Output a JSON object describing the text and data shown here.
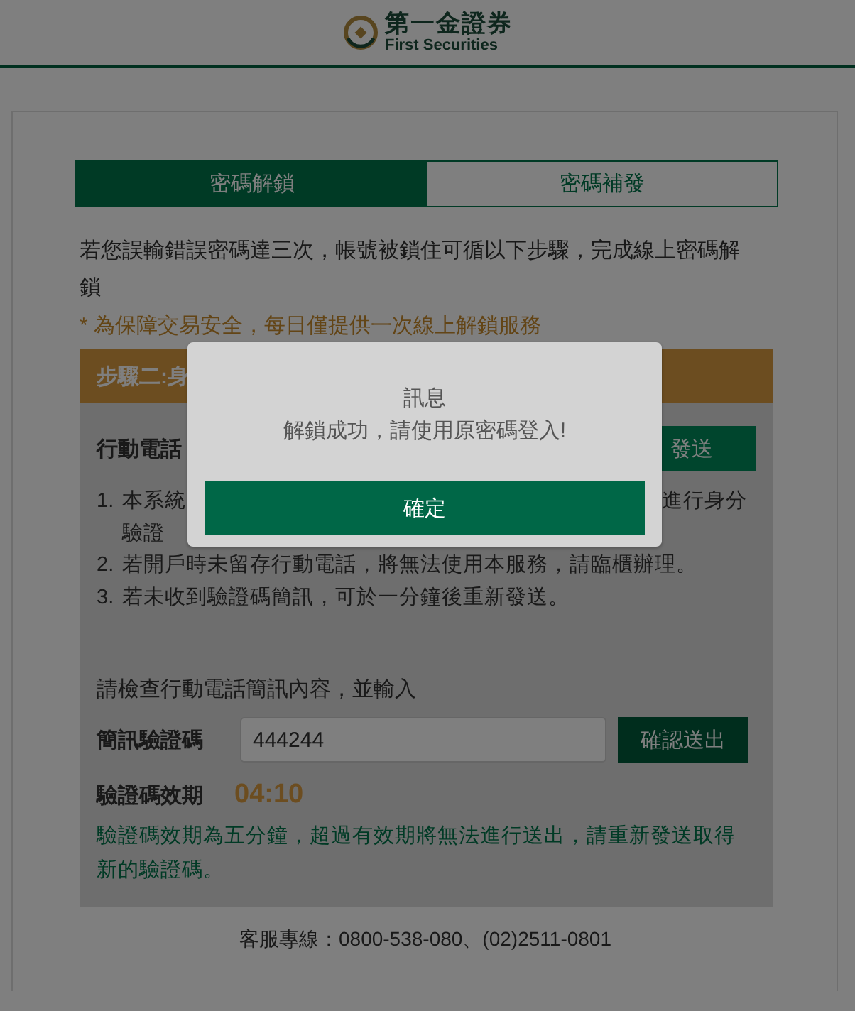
{
  "header": {
    "logo_name": "第一金證券",
    "logo_subtitle": "First Securities"
  },
  "tabs": [
    {
      "label": "密碼解鎖",
      "selected": true
    },
    {
      "label": "密碼補發",
      "selected": false
    }
  ],
  "intro": "若您誤輸錯誤密碼達三次，帳號被鎖住可循以下步驟，完成線上密碼解鎖",
  "notice": "* 為保障交易安全，每日僅提供一次線上解鎖服務",
  "step": {
    "title": "步驟二:身",
    "phone_label": "行動電話",
    "send_button": "發送",
    "notes": [
      {
        "kind": "partial",
        "number": "1.",
        "start": "本系統",
        "end": "進行身分",
        "continuation": "驗證"
      },
      {
        "kind": "full",
        "number": "2.",
        "text": "若開戶時未留存行動電話，將無法使用本服務，請臨櫃辦理。"
      },
      {
        "kind": "full",
        "number": "3.",
        "text": "若未收到驗證碼簡訊，可於一分鐘後重新發送。"
      }
    ],
    "prompt": "請檢查行動電話簡訊內容，並輸入",
    "code_label": "簡訊驗證碼",
    "code_value": "444244",
    "submit_button": "確認送出",
    "expiry_label": "驗證碼效期",
    "expiry_time": "04:10",
    "expiry_note": "驗證碼效期為五分鐘，超過有效期將無法進行送出，請重新發送取得新的驗證碼。"
  },
  "footer": "客服專線：0800-538-080、(02)2511-0801",
  "dialog": {
    "title": "訊息",
    "message": "解鎖成功，請使用原密碼登入!",
    "button": "確定"
  }
}
